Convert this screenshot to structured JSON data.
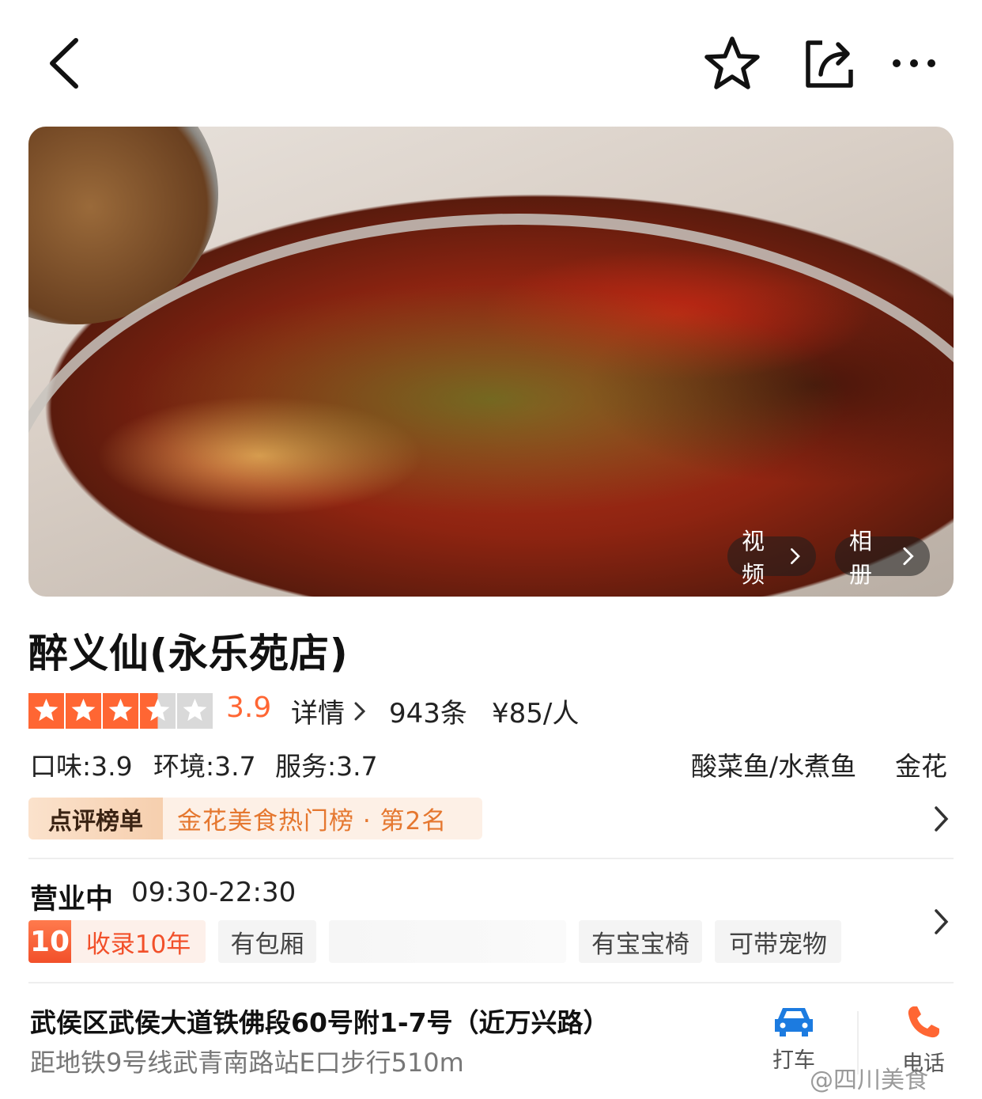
{
  "topbar": {
    "back_icon": "chevron-left-icon",
    "favorite_icon": "star-outline-icon",
    "share_icon": "share-icon",
    "more_icon": "more-dots-icon"
  },
  "hero": {
    "video_label": "视频",
    "album_label": "相册"
  },
  "shop": {
    "name": "醉义仙(永乐苑店)",
    "rating": "3.9",
    "stars": 3.5,
    "detail_label": "详情",
    "review_count": "943条",
    "price": "¥85/人",
    "taste": "口味:3.9",
    "environment": "环境:3.7",
    "service": "服务:3.7",
    "category": "酸菜鱼/水煮鱼",
    "area": "金花",
    "rank_tag": "点评榜单",
    "rank_text": "金花美食热门榜 · 第2名",
    "status": "营业中",
    "hours": "09:30-22:30",
    "years_badge": "10",
    "years_text": "收录10年",
    "features": [
      "有包厢",
      "有宝宝椅",
      "可带宠物"
    ],
    "address": "武侯区武侯大道铁佛段60号附1-7号（近万兴路）",
    "subway": "距地铁9号线武青南路站E口步行510m"
  },
  "actions": {
    "taxi_label": "打车",
    "phone_label": "电话"
  },
  "watermark": "@四川美食",
  "colors": {
    "accent": "#ff6633",
    "rank_text": "#e5772f",
    "icon_blue": "#1c7be0"
  }
}
